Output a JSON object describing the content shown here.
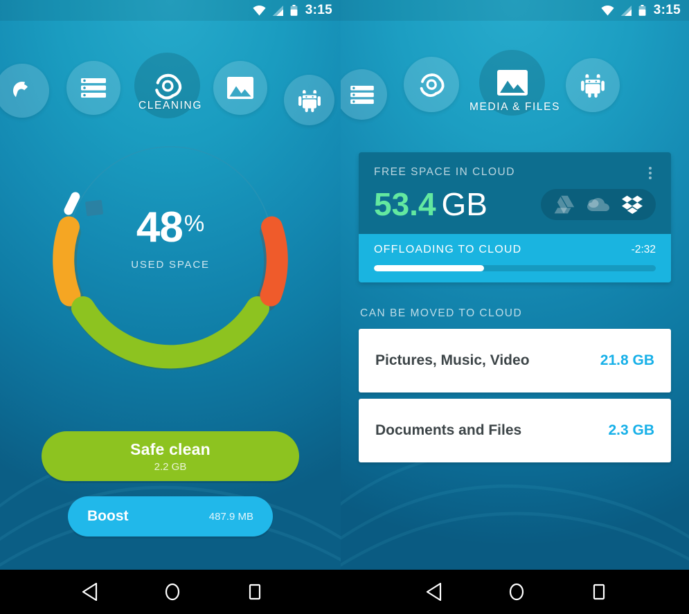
{
  "status_bar": {
    "time": "3:15",
    "icons": [
      "wifi-icon",
      "cellular-signal-icon",
      "battery-icon"
    ]
  },
  "left_panel": {
    "nav": {
      "label": "CLEANING",
      "items": [
        {
          "name": "avast-logo",
          "icon": "avast-logo-icon",
          "active": false
        },
        {
          "name": "storage-list",
          "icon": "storage-list-icon",
          "active": false
        },
        {
          "name": "cleaning",
          "icon": "cleaning-pinwheel-icon",
          "active": true
        },
        {
          "name": "media-files",
          "icon": "photo-icon",
          "active": false
        },
        {
          "name": "apps",
          "icon": "android-robot-icon",
          "active": false
        }
      ]
    },
    "gauge": {
      "percent": "48",
      "percent_symbol": "%",
      "caption": "USED SPACE",
      "value": 48,
      "segments": [
        {
          "name": "junk",
          "color": "#f5a623",
          "start_deg": 200,
          "end_deg": 258
        },
        {
          "name": "safe",
          "color": "#8dc320",
          "start_deg": 272,
          "end_deg": 68
        },
        {
          "name": "risk",
          "color": "#ef5b2b",
          "start_deg": 82,
          "end_deg": 140
        }
      ],
      "track_color": "#2b93b4",
      "marker_color": "#ffffff"
    },
    "safe_clean": {
      "label": "Safe clean",
      "size": "2.2 GB",
      "color": "#8dc320"
    },
    "boost": {
      "label": "Boost",
      "size": "487.9 MB",
      "color": "#21b8ea"
    }
  },
  "right_panel": {
    "nav": {
      "label": "MEDIA & FILES",
      "items": [
        {
          "name": "storage-list",
          "icon": "storage-list-icon",
          "active": false
        },
        {
          "name": "cleaning",
          "icon": "cleaning-pinwheel-icon",
          "active": false
        },
        {
          "name": "media-files",
          "icon": "photo-icon",
          "active": true
        },
        {
          "name": "apps",
          "icon": "android-robot-icon",
          "active": false
        }
      ]
    },
    "cloud_card": {
      "title": "FREE SPACE IN CLOUD",
      "menu_icon": "kebab-menu-icon",
      "free_space_value": "53.4",
      "free_space_unit": "GB",
      "value_color": "#63e8a0",
      "services": [
        {
          "name": "google-drive",
          "icon": "google-drive-icon",
          "active": false
        },
        {
          "name": "onedrive",
          "icon": "onedrive-cloud-icon",
          "active": false
        },
        {
          "name": "dropbox",
          "icon": "dropbox-icon",
          "active": true
        }
      ],
      "offload": {
        "label": "OFFLOADING TO CLOUD",
        "remaining": "-2:32",
        "progress_percent": 39,
        "bar_color": "#1ab4e0"
      }
    },
    "move_section": {
      "title": "CAN BE MOVED TO CLOUD",
      "items": [
        {
          "name": "Pictures, Music, Video",
          "size": "21.8 GB"
        },
        {
          "name": "Documents and Files",
          "size": "2.3 GB"
        }
      ],
      "size_color": "#17b0e8"
    }
  },
  "android_navbar": {
    "buttons": [
      {
        "name": "back",
        "icon": "back-triangle-icon"
      },
      {
        "name": "home",
        "icon": "home-circle-icon"
      },
      {
        "name": "recents",
        "icon": "recents-square-icon"
      }
    ]
  }
}
